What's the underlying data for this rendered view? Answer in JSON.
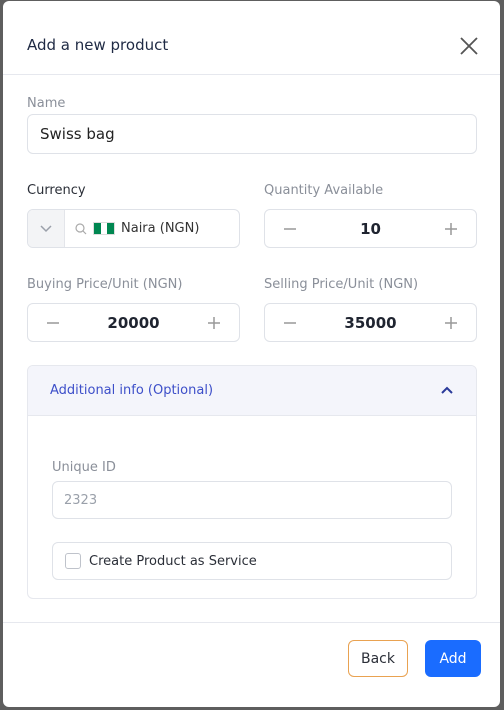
{
  "modal": {
    "title": "Add a new product"
  },
  "form": {
    "name": {
      "label": "Name",
      "value": "Swiss bag"
    },
    "currency": {
      "label": "Currency",
      "value": "Naira (NGN)"
    },
    "quantity": {
      "label": "Quantity Available",
      "value": "10"
    },
    "buying_price": {
      "label": "Buying Price/Unit (NGN)",
      "value": "20000"
    },
    "selling_price": {
      "label": "Selling Price/Unit (NGN)",
      "value": "35000"
    }
  },
  "additional": {
    "title": "Additional info (Optional)",
    "unique_id": {
      "label": "Unique ID",
      "placeholder": "2323"
    },
    "service_label": "Create Product as Service"
  },
  "footer": {
    "back_label": "Back",
    "add_label": "Add"
  },
  "colors": {
    "accent": "#1a6cff",
    "back_border": "#e9a251",
    "accordion_title": "#3d4fc9",
    "flag_green": "#008751"
  }
}
